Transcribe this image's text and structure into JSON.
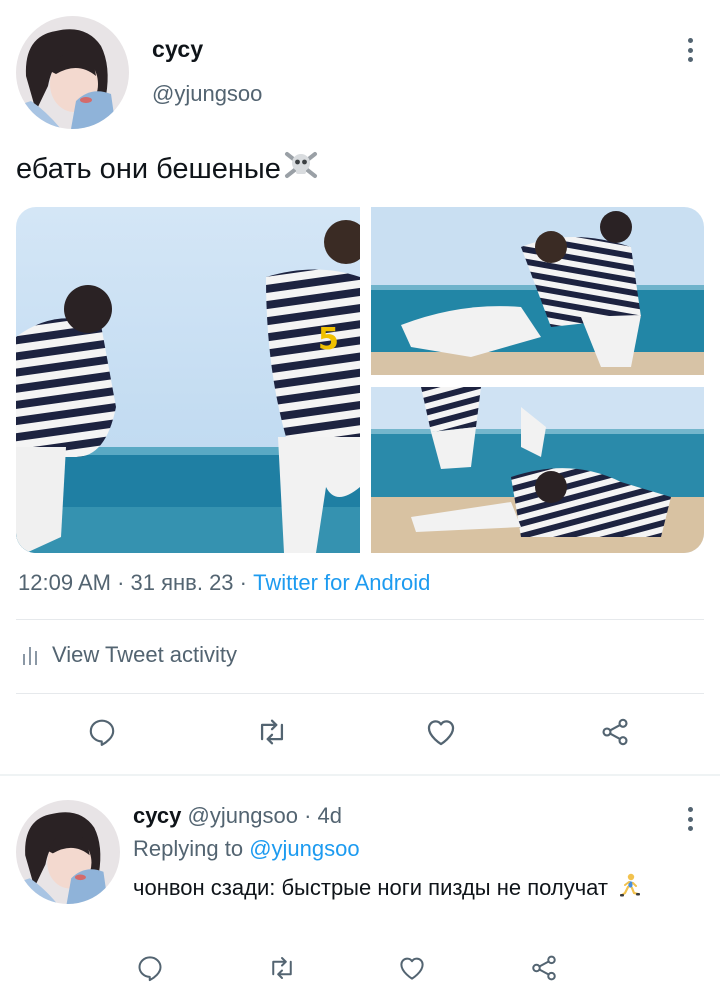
{
  "tweet": {
    "author": {
      "display_name": "сусу",
      "handle": "@yjungsoo"
    },
    "text": "ебать они бешеные",
    "text_emoji": "skull-and-crossbones-icon",
    "media_count": 3,
    "meta": {
      "time": "12:09 AM",
      "date": "31 янв. 23",
      "source": "Twitter for Android",
      "separator": " · "
    },
    "activity_label": "View Tweet activity",
    "actions": [
      "reply-icon",
      "retweet-icon",
      "like-icon",
      "share-icon"
    ]
  },
  "reply": {
    "author": {
      "display_name": "сусу",
      "handle": "@yjungsoo",
      "age": "4d"
    },
    "replying_prefix": "Replying to",
    "replying_to": "@yjungsoo",
    "text": "чонвон сзади: быстрые ноги пизды не получат",
    "text_emoji": "person-running-icon",
    "actions": [
      "reply-icon",
      "retweet-icon",
      "like-icon",
      "share-icon"
    ]
  },
  "colors": {
    "accent": "#1d9bf0",
    "secondary_text": "#536471",
    "primary_text": "#0f1419",
    "divider": "#e6e9ec"
  }
}
